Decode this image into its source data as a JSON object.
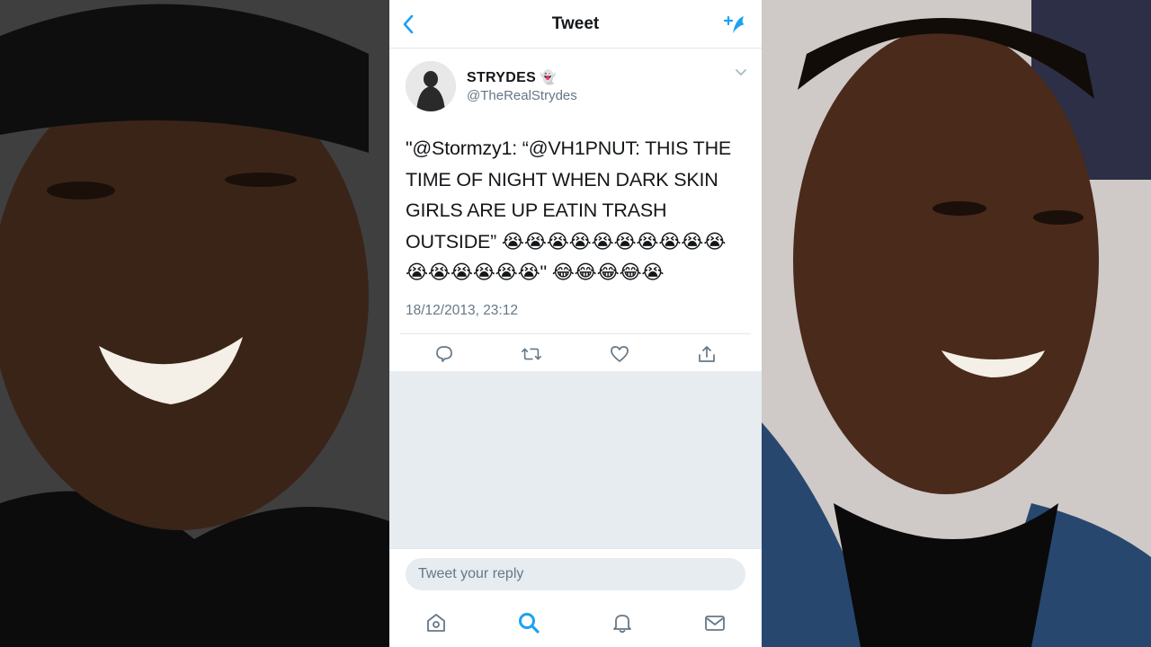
{
  "nav": {
    "title": "Tweet"
  },
  "tweet": {
    "display_name": "STRYDES",
    "name_emoji": "👻",
    "handle": "@TheRealStrydes",
    "text": "\"@Stormzy1: “@VH1PNUT: THIS THE TIME OF NIGHT WHEN DARK SKIN GIRLS ARE UP EATIN TRASH OUTSIDE” 😭😭😭😭😭😭😭😭😭😭😭😭😭😭😭😭\" 😂😂😂😂😭",
    "timestamp": "18/12/2013, 23:12"
  },
  "reply": {
    "placeholder": "Tweet your reply"
  },
  "icons": {
    "back": "chevron-left-icon",
    "compose": "compose-icon",
    "more": "chevron-down-icon",
    "reply": "reply-icon",
    "retweet": "retweet-icon",
    "like": "heart-icon",
    "share": "share-icon",
    "home": "home-icon",
    "search": "search-icon",
    "notifications": "bell-icon",
    "messages": "mail-icon"
  },
  "colors": {
    "accent": "#1da1f2",
    "text": "#14171a",
    "secondary": "#657786",
    "divider": "#e1e8ed",
    "background_gray": "#e6ecf0"
  }
}
